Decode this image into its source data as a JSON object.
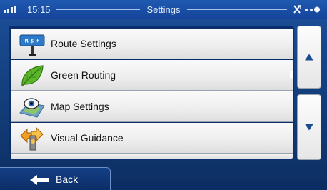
{
  "status": {
    "time": "15:15",
    "title": "Settings"
  },
  "menu": {
    "items": [
      {
        "label": "Route Settings",
        "icon": "route-settings-icon"
      },
      {
        "label": "Green Routing",
        "icon": "green-leaf-icon"
      },
      {
        "label": "Map Settings",
        "icon": "map-settings-icon"
      },
      {
        "label": "Visual Guidance",
        "icon": "visual-guidance-icon"
      }
    ]
  },
  "nav": {
    "back_label": "Back"
  },
  "icon_text": {
    "route_sign": "R $ ✈"
  },
  "colors": {
    "statusbar": "#1f5ab0",
    "background": "#14407f",
    "list_item": "#ededed",
    "leaf_green": "#4faa1e"
  }
}
